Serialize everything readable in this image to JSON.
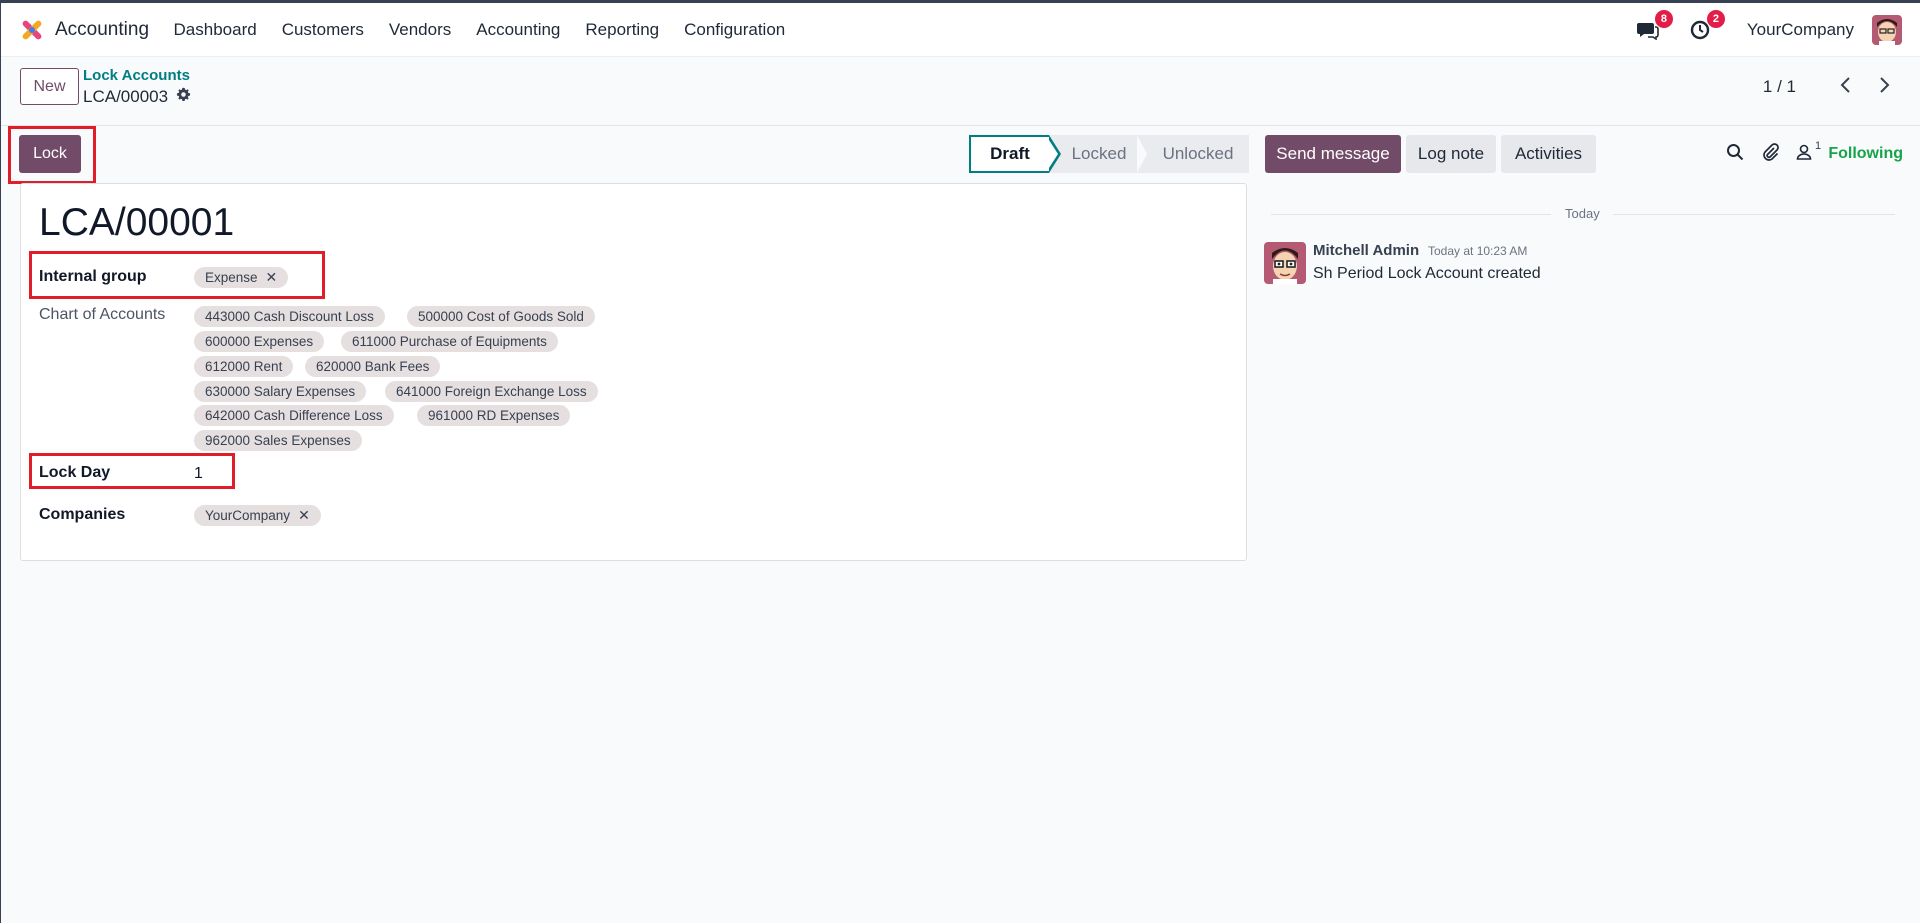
{
  "app": {
    "name": "Accounting"
  },
  "nav": {
    "items": [
      "Dashboard",
      "Customers",
      "Vendors",
      "Accounting",
      "Reporting",
      "Configuration"
    ]
  },
  "systray": {
    "messages_count": "8",
    "activities_count": "2",
    "company": "YourCompany"
  },
  "control_panel": {
    "new_label": "New",
    "breadcrumb": "Lock Accounts",
    "record_ref": "LCA/00003",
    "pager": "1 / 1"
  },
  "statusbar": {
    "lock_label": "Lock",
    "stages": [
      "Draft",
      "Locked",
      "Unlocked"
    ],
    "active_stage": "Draft"
  },
  "form": {
    "title": "LCA/00001",
    "internal_group_label": "Internal group",
    "internal_group_tag": "Expense",
    "chart_of_accounts_label": "Chart of Accounts",
    "accounts": [
      "443000 Cash Discount Loss",
      "500000 Cost of Goods Sold",
      "600000 Expenses",
      "611000 Purchase of Equipments",
      "612000 Rent",
      "620000 Bank Fees",
      "630000 Salary Expenses",
      "641000 Foreign Exchange Loss",
      "642000 Cash Difference Loss",
      "961000 RD Expenses",
      "962000 Sales Expenses"
    ],
    "lock_day_label": "Lock Day",
    "lock_day_value": "1",
    "companies_label": "Companies",
    "companies_tag": "YourCompany"
  },
  "chatter": {
    "send_message": "Send message",
    "log_note": "Log note",
    "activities": "Activities",
    "follower_count": "1",
    "following": "Following",
    "date_separator": "Today",
    "message": {
      "author": "Mitchell Admin",
      "time": "Today at 10:23 AM",
      "body": "Sh Period Lock Account created"
    }
  },
  "colors": {
    "primary": "#714b67",
    "teal": "#017e84",
    "badge": "#e11d48",
    "following": "#16a34a",
    "highlight": "#e11d2a"
  }
}
